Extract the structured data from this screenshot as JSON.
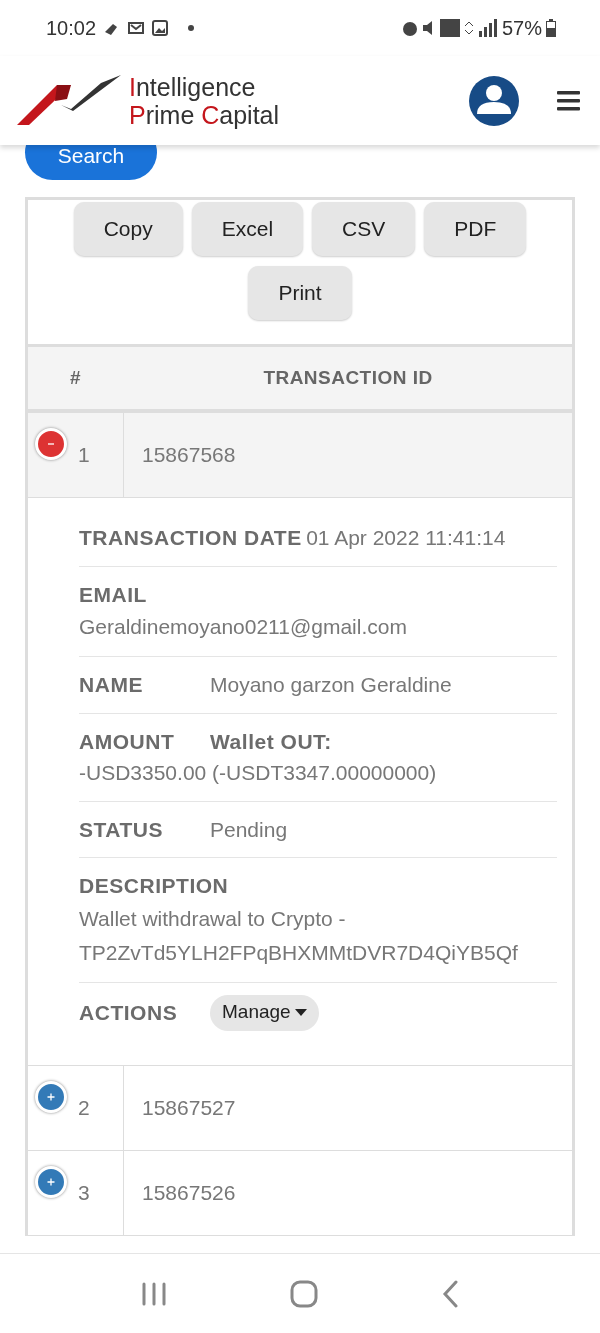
{
  "status_bar": {
    "time": "10:02",
    "battery": "57%"
  },
  "logo": {
    "lines": [
      [
        {
          "text": "I",
          "accent": true
        },
        {
          "text": "ntelligence",
          "accent": false
        }
      ],
      [
        {
          "text": "P",
          "accent": true
        },
        {
          "text": "rime ",
          "accent": false
        },
        {
          "text": "C",
          "accent": true
        },
        {
          "text": "apital",
          "accent": false
        }
      ]
    ]
  },
  "search_button": "Search",
  "export_buttons": [
    "Copy",
    "Excel",
    "CSV",
    "PDF",
    "Print"
  ],
  "table": {
    "columns": [
      "#",
      "TRANSACTION ID"
    ],
    "rows": [
      {
        "number": "1",
        "id": "15867568",
        "expanded": true,
        "details": [
          {
            "kind": "inline",
            "label": "TRANSACTION DATE",
            "value": "01 Apr 2022 11:41:14"
          },
          {
            "kind": "stacked",
            "label": "EMAIL",
            "value": "Geraldinemoyano0211@gmail.com"
          },
          {
            "kind": "column",
            "label": "NAME",
            "value": "Moyano garzon Geraldine"
          },
          {
            "kind": "amount",
            "label": "AMOUNT",
            "heading": "Wallet OUT:",
            "value": "-USD3350.00 (-USDT3347.00000000)"
          },
          {
            "kind": "column",
            "label": "STATUS",
            "value": "Pending"
          },
          {
            "kind": "stacked",
            "label": "DESCRIPTION",
            "value": "Wallet withdrawal to Crypto - TP2ZvTd5YLH2FPqBHXMMtDVR7D4QiYB5Qf"
          },
          {
            "kind": "action",
            "label": "ACTIONS",
            "value": "Manage"
          }
        ]
      },
      {
        "number": "2",
        "id": "15867527",
        "expanded": false
      },
      {
        "number": "3",
        "id": "15867526",
        "expanded": false
      }
    ]
  }
}
